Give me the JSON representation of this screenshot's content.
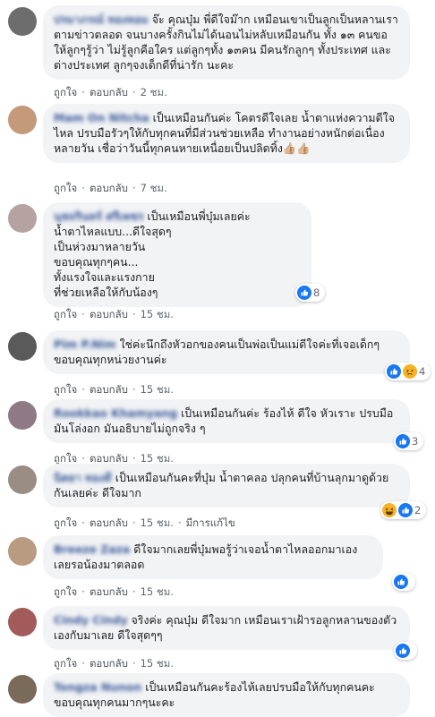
{
  "actions": {
    "like": "ถูกใจ",
    "reply": "ตอบกลับ",
    "separator": "·"
  },
  "colors": {
    "bubble": "#f2f3f5",
    "author": "#385898",
    "like_blue": "#1877f2"
  },
  "comments": [
    {
      "author": "ปรมาภรณ์ ทองหอม",
      "text": "จ๊ะ คุณบุ๋ม พี่ดีใจม๊าก เหมือนเขาเป็นลูกเป็นหลานเรา ตามข่าวตลอด จนบางครั้งกินไม่ได้นอนไม่หลับเหมือนกัน ทั้ง ๑๓ คนขอให้ลูกๆรู้ว่า ไม่รู้ลูกคือใคร แต่ลูกๆทั้ง ๑๓คน มีคนรักลูกๆ ทั้งประเทศ และต่างประเทศ ลูกๆจงเด็กดีที่น่ารัก นะคะ",
      "time": "2 ชม.",
      "reactions": null,
      "avatar_color": "#6d6d6d"
    },
    {
      "author": "Mam On Nitcha",
      "text": "เป็นเหมือนกันค่ะ โคตรดีใจเลย น้ำตาแห่งความดีใจไหล ปรบมือรัวๆให้กับทุกคนที่มีส่วนช่วยเหลือ ทำงานอย่างหนักต่อเนื่องหลายวัน เชื่อว่าวันนี้ทุกคนหายเหนื่อยเป็นปลิดทิ้ง👍🏼👍🏼",
      "time": "7 ชม.",
      "reactions": null,
      "avatar_color": "#c49a7a"
    },
    {
      "author": "นุชจรินทร์ ศรีเพชร",
      "text": "เป็นเหมือนพี่บุ๋มเลยค่ะ\nน้ำตาไหลแบบ...ดีใจสุดๆ\nเป็นห่วงมาหลายวัน\nขอบคุณทุกๆคน...\nทั้งแรงใจและแรงกาย\nที่ช่วยเหลือให้กับน้องๆ",
      "time": "15 ชม.",
      "reactions": {
        "count": "8",
        "icons": [
          "like-icon",
          "love-icon"
        ]
      },
      "avatar_color": "#b4a3a0"
    },
    {
      "author": "Pim P.Nim",
      "text": "ใช่ค่ะนึกถึงหัวอกของคนเป็นพ่อเป็นแม่ดีใจค่ะที่เจอเด็กๆขอบคุณทุกหน่วยงานค่ะ",
      "time": "15 ชม.",
      "reactions": {
        "count": "4",
        "icons": [
          "like-icon",
          "sad-icon"
        ]
      },
      "avatar_color": "#5a5a5a"
    },
    {
      "author": "Rookkao Khamyang",
      "text": "เป็นเหมือนกันค่ะ ร้องไห้ ดีใจ หัวเราะ ปรบมือ มันโล่งอก มันอธิบายไม่ถูกจริง ๆ",
      "time": "15 ชม.",
      "reactions": {
        "count": "3",
        "icons": [
          "like-icon"
        ]
      },
      "avatar_color": "#8e7a86"
    },
    {
      "author": "นิตยา ทองดี",
      "text": "เป็นเหมือนกันคะที่บุ๋ม น้ำตาคลอ ปลุกคนที่บ้านลุกมาดูด้วยกันเลยค่ะ ดีใจมาก",
      "time": "15 ชม.",
      "edited": "มีการแก้ไข",
      "reactions": {
        "count": "2",
        "icons": [
          "haha-icon",
          "like-icon"
        ]
      },
      "avatar_color": "#9a8d84"
    },
    {
      "author": "Breeze Zaza",
      "text": "ดีใจมากเลยพี่บุ๋มพอรู้ว่าเจอน้ำตาไหลออกมาเองเลยรอน้องมาตลอด",
      "time": "15 ชม.",
      "reactions": {
        "count": "",
        "icons": [
          "like-icon"
        ]
      },
      "avatar_color": "#b89b80"
    },
    {
      "author": "Cindy Cindy",
      "text": "จริงค่ะ คุณบุ๋ม ดีใจมาก เหมือนเราเฝ้ารอลูกหลานของตัวเองกับมาเลย ดีใจสุดๆๆ",
      "time": "15 ชม.",
      "reactions": {
        "count": "",
        "icons": [
          "like-icon"
        ]
      },
      "avatar_color": "#a25a5a"
    },
    {
      "author": "Tongza Nunon",
      "text": "เป็นเหมือนกันคะร้องไห้เลยปรบมือให้กับทุกคนคะขอบคุณทุกคนมากๆนะคะ",
      "time": "",
      "reactions": null,
      "avatar_color": "#7a6a5a"
    }
  ]
}
